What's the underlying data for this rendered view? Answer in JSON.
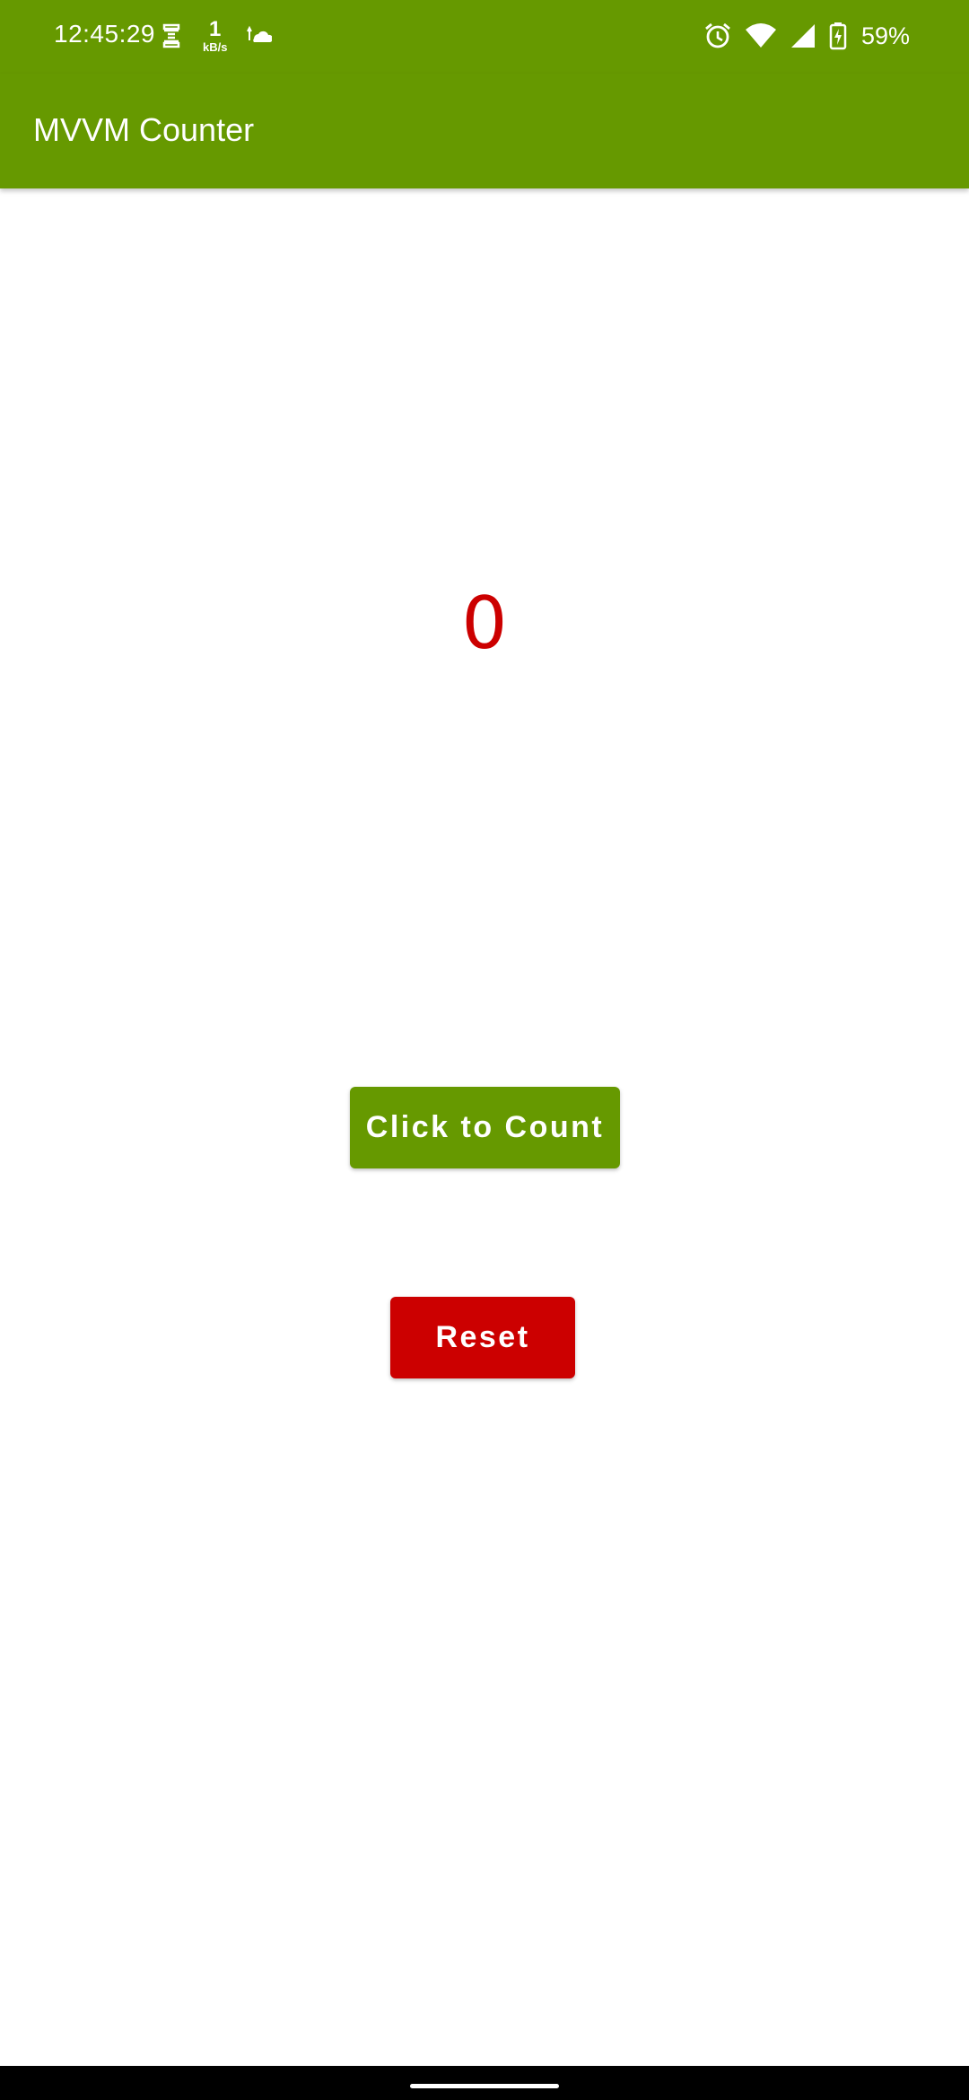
{
  "status_bar": {
    "time": "12:45:29",
    "net_speed_value": "1",
    "net_speed_unit": "kB/s",
    "battery_percent": "59%",
    "icons": [
      "sim-icon",
      "network-speed-indicator",
      "cloud-upload-icon",
      "alarm-icon",
      "wifi-icon",
      "cell-signal-icon",
      "battery-charging-icon"
    ]
  },
  "app_bar": {
    "title": "MVVM Counter",
    "color": "#669900"
  },
  "counter": {
    "value": "0",
    "color": "#cc0000"
  },
  "buttons": {
    "count_label": "Click to Count",
    "count_color": "#669900",
    "reset_label": "Reset",
    "reset_color": "#cc0000"
  }
}
